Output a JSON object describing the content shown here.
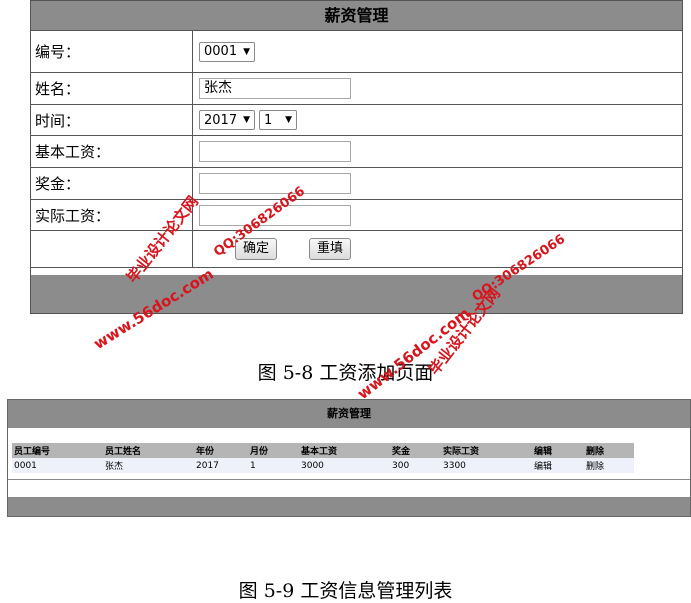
{
  "form": {
    "title": "薪资管理",
    "fields": {
      "id_label": "编号：",
      "id_value": "0001",
      "name_label": "姓名：",
      "name_value": "张杰",
      "time_label": "时间：",
      "year_value": "2017",
      "month_value": "1",
      "base_label": "基本工资：",
      "base_value": "",
      "bonus_label": "奖金：",
      "bonus_value": "",
      "actual_label": "实际工资：",
      "actual_value": ""
    },
    "buttons": {
      "confirm": "确定",
      "reset": "重填"
    },
    "dropdown_icon": "triangle-down-icon"
  },
  "caption1": "图 5-8 工资添加页面",
  "list": {
    "title": "薪资管理",
    "headers": [
      "员工编号",
      "员工姓名",
      "年份",
      "月份",
      "基本工资",
      "奖金",
      "实际工资",
      "编辑",
      "删除"
    ],
    "rows": [
      [
        "0001",
        "张杰",
        "2017",
        "1",
        "3000",
        "300",
        "3300",
        "编辑",
        "删除"
      ]
    ]
  },
  "caption2": "图 5-9 工资信息管理列表",
  "watermarks": {
    "site": "www.56doc.com",
    "qq": "QQ:306826066",
    "brand": "毕业设计论文网"
  },
  "colors": {
    "header_gray": "#8c8c8c",
    "watermark_red": "#d8141c",
    "row_bg": "#eef1fa"
  }
}
